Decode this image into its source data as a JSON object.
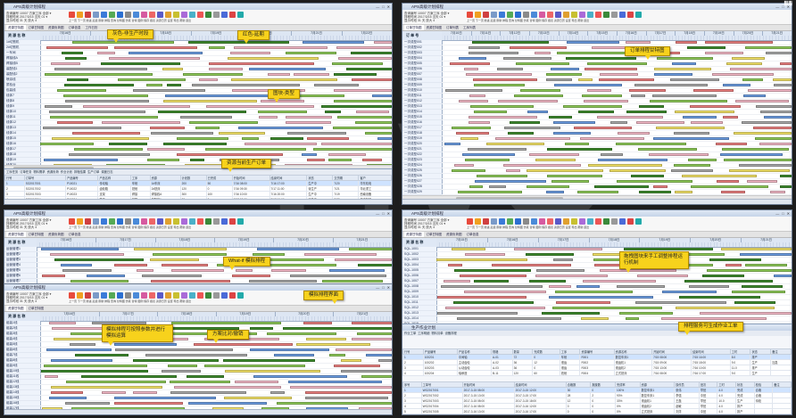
{
  "app": {
    "window_title": "APS高级计划排程",
    "corner_logo": "ⅢⅢ"
  },
  "toolbar": {
    "fields": [
      "查询编号 10007  方案工序 全部  ▾",
      "排程时间 2017/3/15 当天 01 ▾",
      "显示时段 31 天  放大 4"
    ],
    "icons": [
      "#e84a3c",
      "#f0a020",
      "#d04040",
      "#7a9ac8",
      "#3a7ad8",
      "#55aa55",
      "#2b6fd1",
      "#8a8a8a",
      "#4a8ad8",
      "#d65aa0",
      "#e66",
      "#5a5ac8",
      "#e0a030",
      "#c8c030",
      "#aa6ad8",
      "#4ab0c8",
      "#e55",
      "#3a8a3a",
      "#999",
      "#4a6ad8",
      "#d44",
      "#2aa"
    ],
    "labels": "上一页 下一页 前进 后退 刷新 排程 查询 甘特图 仿真 甘特 图例 保存 报表 资源日历 设置 导出 帮助 退出"
  },
  "panels": [
    {
      "id": "top-left",
      "tabs": [
        "资源甘特图",
        "订单甘特图",
        "资源负荷图",
        "订单信息",
        "工作日历"
      ],
      "resource_header": "资 源 名 称",
      "resources": [
        "1#切割机",
        "2#切割机",
        "一车间",
        "焊接线A",
        "焊接线B",
        "装配线1",
        "装配线2",
        "喷涂线",
        "质检台",
        "包装线",
        "线体7",
        "线体8",
        "线体9",
        "线体10",
        "线体11",
        "线体12",
        "线体13",
        "线体14",
        "线体15",
        "线体16",
        "线体17",
        "线体18",
        "线体19",
        "线体20",
        "线体21",
        "线体22",
        "线体23",
        "线体24",
        "线体25"
      ],
      "days": [
        "7月16日",
        "7月17日",
        "7月18日",
        "7月19日",
        "7月20日",
        "7月21日",
        "7月22日"
      ],
      "bottom_tabs": [
        "工序任务",
        "订单任务",
        "物料需求",
        "资源负荷",
        "作业计划",
        "排程结果",
        "生产订单",
        "调度日志"
      ],
      "table_headers": [
        "行号",
        "订单号",
        "产品编号",
        "产品名称",
        "工序",
        "资源",
        "计划数",
        "已完成",
        "开始时间",
        "结束时间",
        "状态",
        "交货期",
        "客户"
      ],
      "table_rows": [
        [
          "1",
          "SO2017001",
          "P10021",
          "传动轴",
          "车削",
          "1#车床",
          "200",
          "50",
          "7/16 08:00",
          "7/16 17:00",
          "生产中",
          "7/20",
          "华东机电"
        ],
        [
          "2",
          "SO2017002",
          "P10022",
          "齿轮箱",
          "铣削",
          "2#铣床",
          "120",
          "0",
          "7/16 09:30",
          "7/17 11:00",
          "待生产",
          "7/21",
          "华北重工"
        ],
        [
          "3",
          "SO2017003",
          "P10023",
          "支架",
          "焊接",
          "焊接线A",
          "300",
          "100",
          "7/16 10:00",
          "7/16 20:00",
          "生产中",
          "7/19",
          "西南设备"
        ],
        [
          "4",
          "SO2017004",
          "P10024",
          "箱体",
          "装配",
          "装配线1",
          "80",
          "0",
          "7/17 08:00",
          "7/17 16:00",
          "待生产",
          "7/22",
          "华南制造"
        ],
        [
          "5",
          "SO2017005",
          "P10025",
          "端盖",
          "喷涂",
          "喷涂线",
          "150",
          "0",
          "7/17 13:00",
          "7/18 09:00",
          "待生产",
          "7/23",
          "东北机械"
        ],
        [
          "6",
          "SO2017006",
          "P10026",
          "法兰",
          "质检",
          "质检台",
          "240",
          "240",
          "7/15 08:00",
          "7/15 18:00",
          "已完成",
          "7/18",
          "华中电气"
        ]
      ]
    },
    {
      "id": "top-right",
      "tabs": [
        "订单甘特图",
        "资源甘特图",
        "订单列表",
        "工序列表"
      ],
      "resource_header": "订 单 号",
      "resources": [
        "一次成型001",
        "一次成型002",
        "一次成型003",
        "一次成型004",
        "一次成型005",
        "一次成型006",
        "一次成型007",
        "一次成型008",
        "一次成型009",
        "一次成型010",
        "一次成型011",
        "一次成型012",
        "一次成型013",
        "一次成型014",
        "一次成型015",
        "一次成型016",
        "一次成型017",
        "一次成型018",
        "一次成型019",
        "一次成型020",
        "一次成型021",
        "一次成型022",
        "一次成型023",
        "一次成型024",
        "一次成型025",
        "一次成型026",
        "一次成型027",
        "一次成型028",
        "一次成型029",
        "一次成型030",
        "一次成型031",
        "一次成型032",
        "一次成型033",
        "一次成型034",
        "一次成型035"
      ],
      "days": [
        "7月10日",
        "7月11日",
        "7月12日",
        "7月13日",
        "7月14日",
        "7月15日",
        "7月16日",
        "7月17日",
        "7月18日",
        "7月19日",
        "7月20日",
        "7月21日"
      ]
    },
    {
      "id": "bottom-left",
      "tabs": [
        "资源甘特图",
        "订单甘特图",
        "资源负荷图",
        "订单信息"
      ],
      "resource_header": "资 源 名 称",
      "resources": [
        "运营管理1",
        "运营管理2",
        "运营管理3",
        "运营管理4",
        "运营管理5",
        "运营管理6",
        "运营管理7",
        "运营管理8",
        "运营管理9",
        "运营管理10",
        "运营管理11"
      ],
      "days": [
        "7月16日",
        "7月17日",
        "7月18日",
        "7月19日",
        "7月20日",
        "7月21日"
      ]
    },
    {
      "id": "bottom-left-inner",
      "tabs": [
        "资源甘特图",
        "订单甘特图"
      ],
      "resource_header": "资 源 名 称",
      "resources": [
        "组装1线",
        "组装2线",
        "组装3线",
        "组装4线",
        "组装5线",
        "组装6线",
        "组装7线",
        "组装8线",
        "组装9线",
        "组装10线",
        "组装11线",
        "组装12线",
        "组装13线",
        "组装14线",
        "组装15线",
        "组装16线",
        "组装17线",
        "组装18线"
      ],
      "days": [
        "7月16日",
        "7月17日",
        "7月18日",
        "7月19日",
        "7月20日",
        "7月21日"
      ]
    },
    {
      "id": "bottom-right",
      "tabs": [
        "资源甘特图",
        "订单甘特图",
        "资源负荷图",
        "订单信息"
      ],
      "resource_header": "资 源 名 称",
      "resources": [
        "SQL-1001",
        "SQL-1002",
        "SQL-1003",
        "SQL-1004",
        "SQL-1005",
        "SQL-1006",
        "SQL-1007",
        "SQL-1008",
        "SQL-1009",
        "SQL-1010",
        "SQL-1011",
        "SQL-1012",
        "SQL-1013",
        "SQL-1014",
        "SQL-1015",
        "SQL-1016",
        "SQL-1017"
      ],
      "days": [
        "7月15日",
        "7月16日",
        "7月17日",
        "7月18日",
        "7月19日",
        "7月20日",
        "7月21日"
      ]
    },
    {
      "id": "bottom-right-dialog",
      "title": "生产作业计划",
      "tabs": [
        "作业工单",
        "工序明细",
        "物料清单",
        "设备排程"
      ],
      "table_headers": [
        "行号",
        "产品编号",
        "产品名称",
        "规格",
        "数量",
        "完成数",
        "工序",
        "资源编号",
        "资源名称",
        "开始时间",
        "结束时间",
        "工时",
        "状态",
        "备注"
      ],
      "table_rows": [
        [
          "1",
          "100201",
          "中间轴",
          "A-01",
          "72",
          "0",
          "车削",
          "R001",
          "数控车床1",
          "7/15 08:00",
          "7/15 16:00",
          "8.0",
          "排产",
          ""
        ],
        [
          "2",
          "100202",
          "主动齿轮",
          "A-02",
          "36",
          "12",
          "滚齿",
          "R002",
          "滚齿机1",
          "7/15 09:00",
          "7/15 18:00",
          "9.0",
          "生产",
          "加急"
        ],
        [
          "3",
          "100203",
          "从动齿轮",
          "A-03",
          "36",
          "0",
          "滚齿",
          "R003",
          "滚齿机2",
          "7/15 13:00",
          "7/16 10:00",
          "11.0",
          "排产",
          ""
        ],
        [
          "4",
          "100204",
          "轴承座",
          "B-11",
          "120",
          "60",
          "铣削",
          "R004",
          "立式铣床",
          "7/16 08:00",
          "7/16 17:00",
          "9.0",
          "生产",
          ""
        ]
      ],
      "sub_headers": [
        "序号",
        "工单号",
        "开始时间",
        "结束时间",
        "合格数",
        "报废数",
        "完成率",
        "资源",
        "操作员",
        "班次",
        "工时",
        "状态",
        "检验",
        "备注"
      ],
      "sub_rows": [
        [
          "1",
          "WO2017001",
          "2017-3-15 08:00",
          "2017-3-15 12:00",
          "30",
          "0",
          "100%",
          "数控车床1",
          "张伟",
          "早班",
          "4.0",
          "完成",
          "合格",
          ""
        ],
        [
          "2",
          "WO2017002",
          "2017-3-15 13:00",
          "2017-3-15 17:00",
          "28",
          "2",
          "93%",
          "数控车床1",
          "李强",
          "中班",
          "4.0",
          "完成",
          "合格",
          ""
        ],
        [
          "3",
          "WO2017003",
          "2017-3-15 08:00",
          "2017-3-15 18:00",
          "12",
          "0",
          "33%",
          "滚齿机1",
          "王磊",
          "早班",
          "10.0",
          "生产",
          "待检",
          ""
        ],
        [
          "4",
          "WO2017004",
          "2017-3-16 08:00",
          "2017-3-16 12:00",
          "0",
          "0",
          "0%",
          "滚齿机2",
          "赵敏",
          "早班",
          "4.0",
          "排产",
          "",
          ""
        ],
        [
          "5",
          "WO2017005",
          "2017-3-16 13:00",
          "2017-3-16 17:00",
          "0",
          "0",
          "0%",
          "立式铣床",
          "刘洋",
          "中班",
          "4.0",
          "排产",
          "",
          ""
        ],
        [
          "6",
          "WO2017006",
          "2017-3-16 08:00",
          "2017-3-16 17:00",
          "60",
          "0",
          "50%",
          "立式铣床",
          "陈静",
          "早班",
          "9.0",
          "生产",
          "合格",
          ""
        ]
      ]
    }
  ],
  "callouts": {
    "gray_non_production": "灰色-非生产时段",
    "red_delay": "红色-延期",
    "bar_type": "图块-类型",
    "resource_orders": "资源当前生产订单",
    "order_gantt": "订单排程甘特图",
    "what_if": "What-if 模拟排程",
    "sim_params": "模拟排程可按照参数并进行模拟运算",
    "compare": "方案比对/撤销",
    "sim_interface": "模拟排程界面",
    "drag_reschedule": "拖拽图块来手工调整排程运行机制",
    "work_order": "排程服务可生成作业工单"
  },
  "colors": {
    "green": "#8ec95a",
    "dark_green": "#3f8a2f",
    "red": "#e98080",
    "pink": "#f2b8c6",
    "gray": "#a9a9a9",
    "blue": "#6d9de0",
    "yellow": "#f3e36a",
    "callout": "#f7d21c"
  }
}
